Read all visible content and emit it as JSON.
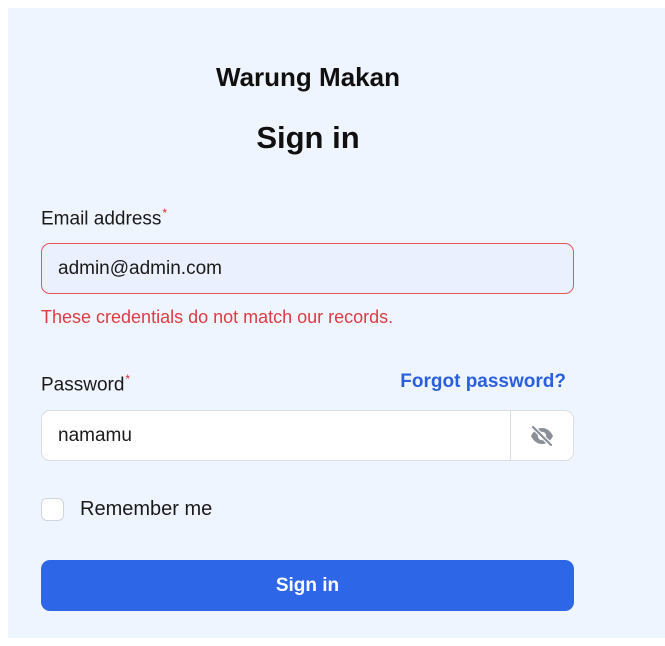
{
  "brand": "Warung Makan",
  "title": "Sign in",
  "email": {
    "label": "Email address",
    "required_mark": "*",
    "value": "admin@admin.com",
    "error": "These credentials do not match our records."
  },
  "password": {
    "label": "Password",
    "required_mark": "*",
    "value": "namamu",
    "toggle_icon": "eye-slash-icon",
    "forgot_link": "Forgot password?"
  },
  "remember": {
    "label": "Remember me",
    "checked": false
  },
  "submit_label": "Sign in",
  "colors": {
    "background": "#eff5fe",
    "primary": "#2d67e7",
    "link": "#2a5fde",
    "error": "#dc3b43"
  }
}
